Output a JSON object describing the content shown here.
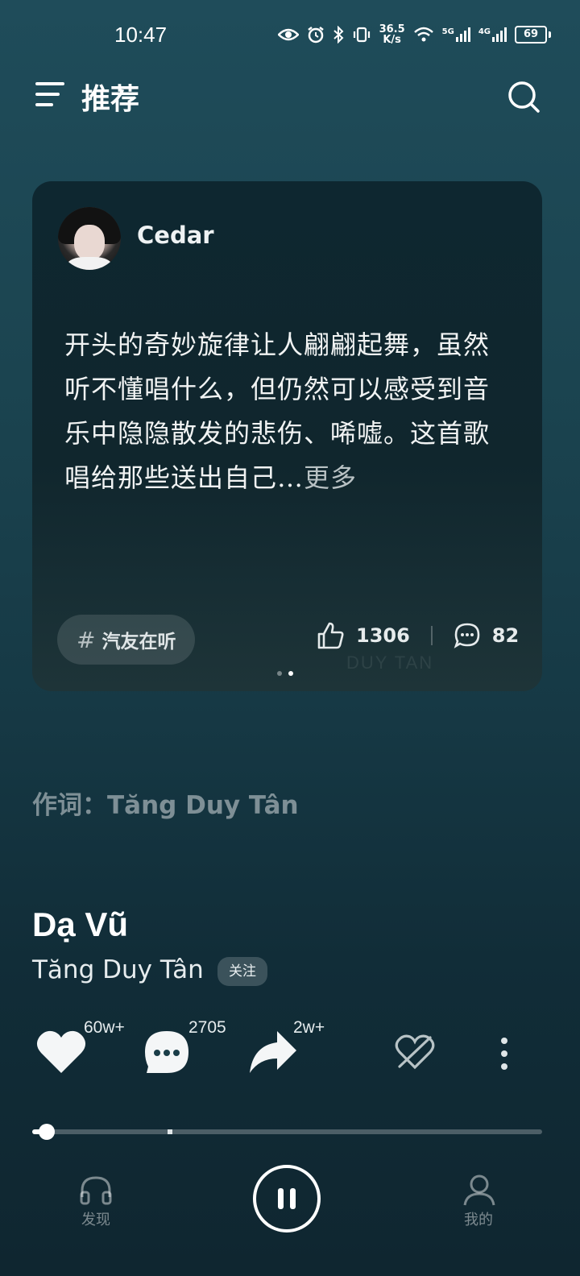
{
  "status_bar": {
    "time": "10:47",
    "net_speed_top": "36.5",
    "net_speed_bottom": "K/s",
    "sig1": "5G",
    "sig2": "4G",
    "battery": "69"
  },
  "header": {
    "title": "推荐",
    "menu_icon": "menu-icon",
    "search_icon": "search-icon"
  },
  "comment_card": {
    "username": "Cedar",
    "text": "开头的奇妙旋律让人翩翩起舞，虽然听不懂唱什么，但仍然可以感受到音乐中隐隐散发的悲伤、唏嘘。这首歌唱给那些送出自己…",
    "more": "更多",
    "tag": "汽友在听",
    "likes": "1306",
    "comments": "82",
    "watermark": "DUY TAN",
    "page_dots": 2,
    "active_dot": 2
  },
  "lyricist": "作词：Tăng Duy Tân",
  "song": {
    "title": "Dạ Vũ",
    "artist": "Tăng Duy Tân",
    "follow": "关注"
  },
  "actions": {
    "like_count": "60w+",
    "comment_count": "2705",
    "share_count": "2w+"
  },
  "playback": {
    "progress": 0.03
  },
  "bottom_nav": {
    "discover": "发现",
    "mine": "我的"
  },
  "colors": {
    "bg_top": "#1f4c5a",
    "bg_bottom": "#0f2630",
    "card_bg": "#0e2730"
  }
}
